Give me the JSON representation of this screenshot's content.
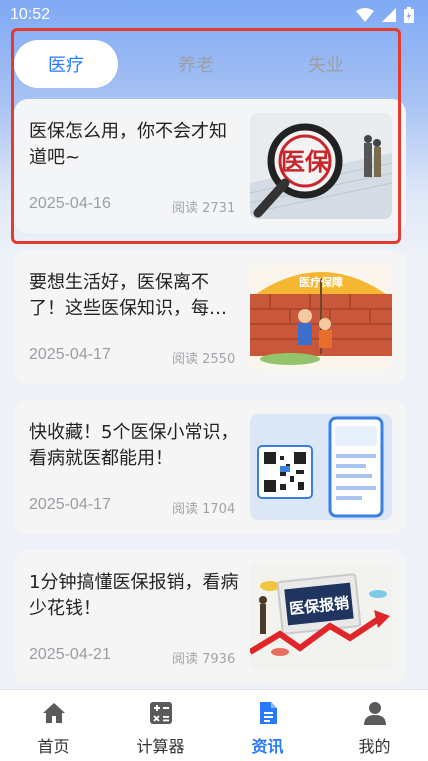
{
  "status_bar": {
    "time": "10:52"
  },
  "tabs": [
    {
      "label": "医疗",
      "active": true
    },
    {
      "label": "养老",
      "active": false
    },
    {
      "label": "失业",
      "active": false
    }
  ],
  "articles": [
    {
      "title": "医保怎么用，你不会才知道吧~",
      "date": "2025-04-16",
      "reads": "阅读 2731",
      "thumb_text": "医保"
    },
    {
      "title": "要想生活好，医保离不了！这些医保知识，每…",
      "date": "2025-04-17",
      "reads": "阅读 2550",
      "thumb_text": "医疗保障"
    },
    {
      "title": "快收藏！5个医保小常识，看病就医都能用！",
      "date": "2025-04-17",
      "reads": "阅读 1704",
      "thumb_text": ""
    },
    {
      "title": "1分钟搞懂医保报销，看病少花钱！",
      "date": "2025-04-21",
      "reads": "阅读 7936",
      "thumb_text": "医保报销"
    }
  ],
  "bottom_nav": [
    {
      "label": "首页",
      "icon": "home-icon",
      "active": false
    },
    {
      "label": "计算器",
      "icon": "calculator-icon",
      "active": false
    },
    {
      "label": "资讯",
      "icon": "news-icon",
      "active": true
    },
    {
      "label": "我的",
      "icon": "profile-icon",
      "active": false
    }
  ],
  "colors": {
    "accent": "#2979ff",
    "highlight": "#e53a2f",
    "inactive": "#9a9fa8"
  }
}
